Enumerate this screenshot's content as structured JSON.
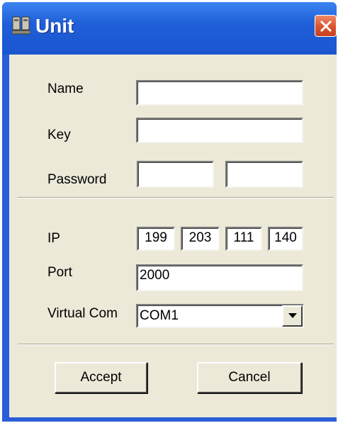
{
  "window": {
    "title": "Unit",
    "app_icon": "network-icon",
    "close_icon": "close-icon"
  },
  "form": {
    "name": {
      "label": "Name",
      "value": ""
    },
    "key": {
      "label": "Key",
      "value": ""
    },
    "password": {
      "label": "Password",
      "value_1": "",
      "value_2": ""
    },
    "ip": {
      "label": "IP",
      "octets": [
        "199",
        "203",
        "111",
        "140"
      ]
    },
    "port": {
      "label": "Port",
      "value": "2000"
    },
    "virtual_com": {
      "label": "Virtual Com",
      "selected": "COM1",
      "dropdown_icon": "chevron-down-icon"
    }
  },
  "buttons": {
    "accept": "Accept",
    "cancel": "Cancel"
  },
  "colors": {
    "titlebar": "#1f5fd8",
    "client_bg": "#ece9d8",
    "close_button": "#d9522e"
  }
}
